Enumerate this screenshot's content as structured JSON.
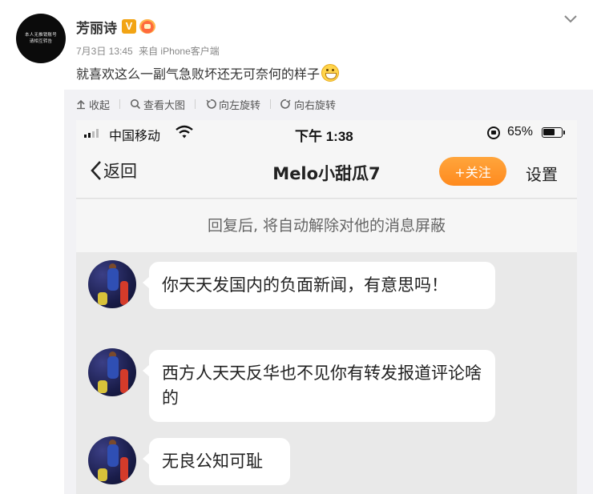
{
  "post": {
    "avatar_text": [
      "本人无推销账号",
      "请相互转告"
    ],
    "username": "芳丽诗",
    "verified_badge": "V",
    "date": "7月3日 13:45",
    "source": "来自 iPhone客户端",
    "text": "就喜欢这么一副气急败坏还无可奈何的样子",
    "emoji": "grin-emoji"
  },
  "toolbar": {
    "collapse": "收起",
    "view_large": "查看大图",
    "rotate_left": "向左旋转",
    "rotate_right": "向右旋转"
  },
  "phone": {
    "status": {
      "carrier": "中国移动",
      "time": "下午 1:38",
      "battery": "65%"
    },
    "nav": {
      "back": "返回",
      "title": "Melo小甜瓜7",
      "follow": "+关注",
      "settings": "设置"
    },
    "notice": "回复后, 将自动解除对他的消息屏蔽",
    "messages": [
      {
        "text": "你天天发国内的负面新闻，有意思吗！"
      },
      {
        "text": "西方人天天反华也不见你有转发报道评论啥的"
      },
      {
        "text": "无良公知可耻"
      }
    ]
  },
  "colors": {
    "follow_button": "#ff9a2e",
    "verified_badge": "#f2a414",
    "viewer_bg": "#f2f2f5"
  }
}
